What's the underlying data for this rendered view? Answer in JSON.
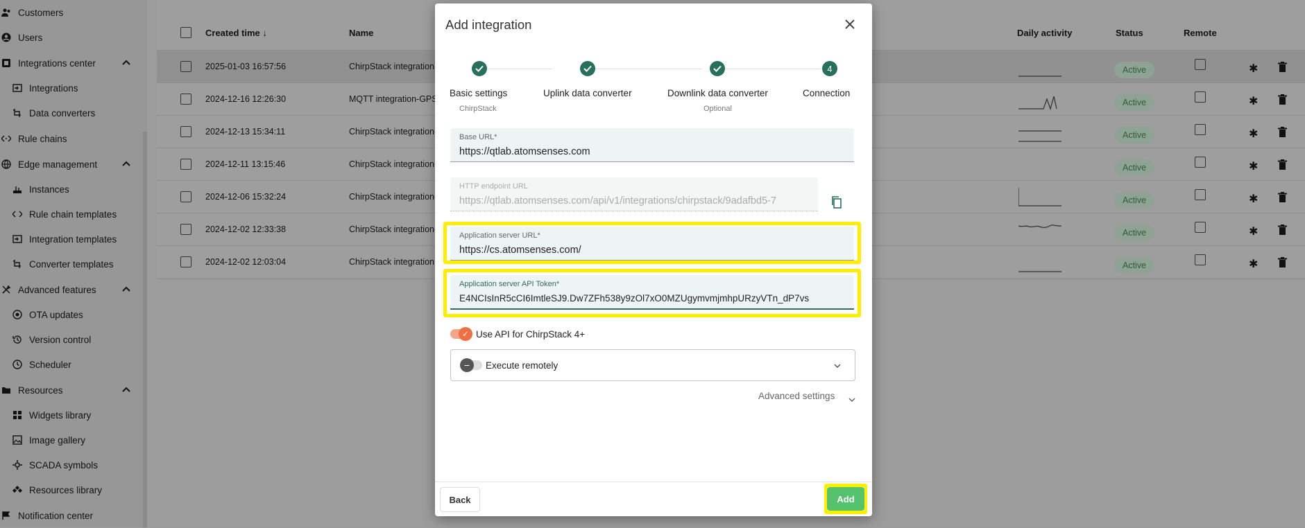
{
  "sidebar": {
    "items": [
      {
        "label": "Customers",
        "icon": "customers-icon"
      },
      {
        "label": "Users",
        "icon": "account-icon"
      },
      {
        "label": "Integrations center",
        "icon": "integrations-center-icon"
      },
      {
        "label": "Integrations",
        "icon": "input-icon"
      },
      {
        "label": "Data converters",
        "icon": "transform-icon"
      },
      {
        "label": "Rule chains",
        "icon": "rule-chain-icon"
      },
      {
        "label": "Edge management",
        "icon": "router-icon"
      },
      {
        "label": "Instances",
        "icon": "instances-icon"
      },
      {
        "label": "Rule chain templates",
        "icon": "rule-chain-template-icon"
      },
      {
        "label": "Integration templates",
        "icon": "integration-template-icon"
      },
      {
        "label": "Converter templates",
        "icon": "converter-template-icon"
      },
      {
        "label": "Advanced features",
        "icon": "build-icon"
      },
      {
        "label": "OTA updates",
        "icon": "ota-icon"
      },
      {
        "label": "Version control",
        "icon": "history-icon"
      },
      {
        "label": "Scheduler",
        "icon": "clock-icon"
      },
      {
        "label": "Resources",
        "icon": "folder-icon"
      },
      {
        "label": "Widgets library",
        "icon": "widgets-icon"
      },
      {
        "label": "Image gallery",
        "icon": "image-icon"
      },
      {
        "label": "SCADA symbols",
        "icon": "scada-icon"
      },
      {
        "label": "Resources library",
        "icon": "library-icon"
      },
      {
        "label": "Notification center",
        "icon": "notification-icon"
      }
    ]
  },
  "table": {
    "columns": {
      "created": "Created time",
      "name": "Name",
      "daily": "Daily activity",
      "status": "Status",
      "remote": "Remote"
    },
    "rows": [
      {
        "created": "2025-01-03 16:57:56",
        "name": "ChirpStack integration-G",
        "status": "Active"
      },
      {
        "created": "2024-12-16 12:26:30",
        "name": "MQTT integration-GPS",
        "status": "Active"
      },
      {
        "created": "2024-12-13 15:34:11",
        "name": "ChirpStack integration-C",
        "status": "Active"
      },
      {
        "created": "2024-12-11 13:15:46",
        "name": "ChirpStack integration-C",
        "status": "Active"
      },
      {
        "created": "2024-12-06 15:32:24",
        "name": "ChirpStack integration-F",
        "status": "Active"
      },
      {
        "created": "2024-12-02 12:33:38",
        "name": "ChirpStack integration-A",
        "status": "Active"
      },
      {
        "created": "2024-12-02 12:03:04",
        "name": "ChirpStack integration",
        "status": "Active"
      }
    ]
  },
  "dialog": {
    "title": "Add integration",
    "steps": [
      {
        "label": "Basic settings",
        "sub": "ChirpStack",
        "marker": ""
      },
      {
        "label": "Uplink data converter",
        "sub": "",
        "marker": ""
      },
      {
        "label": "Downlink data converter",
        "sub": "Optional",
        "marker": ""
      },
      {
        "label": "Connection",
        "sub": "",
        "marker": "4"
      }
    ],
    "base_url": {
      "label": "Base URL*",
      "value": "https://qtlab.atomsenses.com"
    },
    "http_endpoint": {
      "label": "HTTP endpoint URL",
      "value": "https://qtlab.atomsenses.com/api/v1/integrations/chirpstack/9adafbd5-7"
    },
    "app_server_url": {
      "label": "Application server URL*",
      "value": "https://cs.atomsenses.com/"
    },
    "api_token": {
      "label": "Application server API Token*",
      "value": "E4NCIsInR5cCI6ImtleSJ9.Dw7ZFh538y9zOl7xO0MZUgymvmjmhpURzyVTn_dP7vs"
    },
    "use_api_label": "Use API for ChirpStack 4+",
    "execute_remotely_label": "Execute remotely",
    "advanced_settings_label": "Advanced settings",
    "back_label": "Back",
    "add_label": "Add"
  },
  "colors": {
    "accent": "#29705a",
    "highlight": "#ffee00",
    "add_button": "#55c26e",
    "toggle_on": "#f07043"
  }
}
